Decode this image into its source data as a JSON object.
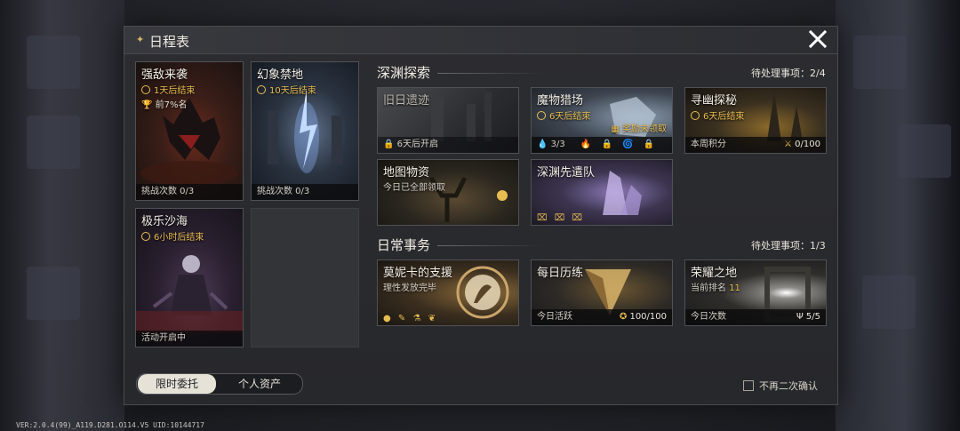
{
  "window": {
    "title": "日程表",
    "close_icon": "close-icon"
  },
  "limited": {
    "cards": [
      {
        "name": "强敌来袭",
        "timer": "1天后结束",
        "rank": "前7%名",
        "footer": "挑战次数 0/3"
      },
      {
        "name": "幻象禁地",
        "timer": "10天后结束",
        "footer": "挑战次数 0/3"
      },
      {
        "name": "极乐沙海",
        "timer": "6小时后结束",
        "footer": "活动开启中"
      }
    ]
  },
  "abyss": {
    "title": "深渊探索",
    "pending": "待处理事项：2/4",
    "cards": [
      {
        "name": "旧日遗迹",
        "footer": "6天后开启"
      },
      {
        "name": "魔物猎场",
        "timer": "6天后结束",
        "reward": "奖励未领取",
        "count": "3/3"
      },
      {
        "name": "寻幽探秘",
        "timer": "6天后结束",
        "footer": "本周积分",
        "score": "0/100"
      },
      {
        "name": "地图物资",
        "sub": "今日已全部领取"
      },
      {
        "name": "深渊先遣队"
      }
    ]
  },
  "daily": {
    "title": "日常事务",
    "pending": "待处理事项：1/3",
    "cards": [
      {
        "name": "莫妮卡的支援",
        "sub": "理性发放完毕"
      },
      {
        "name": "每日历练",
        "footer": "今日活跃",
        "value": "100/100"
      },
      {
        "name": "荣耀之地",
        "rank_label": "当前排名",
        "rank_value": "11",
        "footer": "今日次数",
        "value": "5/5"
      }
    ]
  },
  "tabs": {
    "active": "限时委托",
    "inactive": "个人资产"
  },
  "confirm_label": "不再二次确认",
  "version": "VER:2.0.4(99)_A119.D281.O114.V5   UID:10144717",
  "colors": {
    "accent": "#e8bd52",
    "panel": "#2c2d31"
  }
}
